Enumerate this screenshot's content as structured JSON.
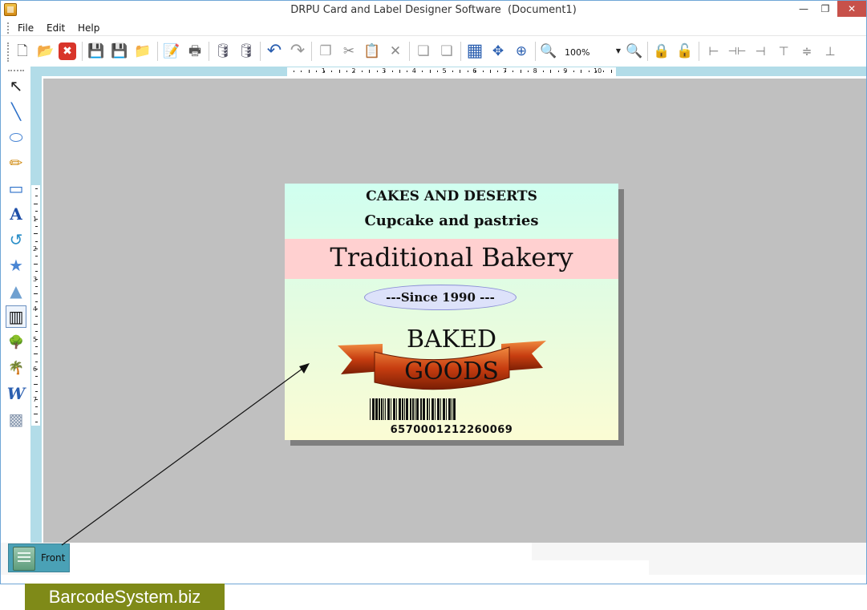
{
  "window": {
    "title": "DRPU Card and Label Designer Software  (Document1)",
    "minimize_glyph": "—",
    "maximize_glyph": "❐",
    "close_glyph": "✕"
  },
  "menu": {
    "items": [
      "File",
      "Edit",
      "Help"
    ]
  },
  "toolbar": {
    "zoom_value": "100%",
    "buttons": [
      {
        "name": "new-icon",
        "glyph": "🗋"
      },
      {
        "name": "open-folder-icon",
        "glyph": "📂"
      },
      {
        "name": "close-document-icon",
        "glyph": "✖"
      },
      {
        "name": "save-icon",
        "glyph": "💾"
      },
      {
        "name": "save-as-icon",
        "glyph": "💾"
      },
      {
        "name": "export-icon",
        "glyph": "📁"
      },
      {
        "name": "properties-icon",
        "glyph": "📝"
      },
      {
        "name": "print-icon",
        "glyph": "🖶"
      },
      {
        "name": "database-add-icon",
        "glyph": "🛢"
      },
      {
        "name": "database-icon",
        "glyph": "🛢"
      },
      {
        "name": "undo-icon",
        "glyph": "↶"
      },
      {
        "name": "redo-icon",
        "glyph": "↷"
      },
      {
        "name": "copy-icon",
        "glyph": "❐"
      },
      {
        "name": "cut-icon",
        "glyph": "✂"
      },
      {
        "name": "paste-icon",
        "glyph": "📋"
      },
      {
        "name": "delete-icon",
        "glyph": "✕"
      },
      {
        "name": "bring-forward-icon",
        "glyph": "❏"
      },
      {
        "name": "send-backward-icon",
        "glyph": "❏"
      },
      {
        "name": "grid-icon",
        "glyph": "▦"
      },
      {
        "name": "fit-page-icon",
        "glyph": "✥"
      },
      {
        "name": "zoom-fit-icon",
        "glyph": "⊕"
      },
      {
        "name": "zoom-in-icon",
        "glyph": "🔍"
      },
      {
        "name": "zoom-out-icon",
        "glyph": "🔍"
      },
      {
        "name": "lock-icon",
        "glyph": "🔒"
      },
      {
        "name": "unlock-icon",
        "glyph": "🔓"
      },
      {
        "name": "align-left-icon",
        "glyph": "⊢"
      },
      {
        "name": "align-center-icon",
        "glyph": "⊣⊢"
      },
      {
        "name": "align-right-icon",
        "glyph": "⊣"
      },
      {
        "name": "align-top-icon",
        "glyph": "⊤"
      },
      {
        "name": "align-middle-icon",
        "glyph": "≑"
      },
      {
        "name": "align-bottom-icon",
        "glyph": "⊥"
      }
    ]
  },
  "palette": {
    "tools": [
      {
        "name": "select-move-tool-icon",
        "glyph": "↖"
      },
      {
        "name": "line-tool-icon",
        "glyph": "╲"
      },
      {
        "name": "ellipse-tool-icon",
        "glyph": "⬭"
      },
      {
        "name": "pencil-tool-icon",
        "glyph": "✏"
      },
      {
        "name": "rectangle-tool-icon",
        "glyph": "▭"
      },
      {
        "name": "text-tool-icon",
        "glyph": "A"
      },
      {
        "name": "curve-tool-icon",
        "glyph": "↺"
      },
      {
        "name": "star-tool-icon",
        "glyph": "★"
      },
      {
        "name": "triangle-tool-icon",
        "glyph": "▲"
      },
      {
        "name": "barcode-tool-icon",
        "glyph": "▥"
      },
      {
        "name": "picture-tool-icon",
        "glyph": "🌳"
      },
      {
        "name": "image-library-tool-icon",
        "glyph": "🌴"
      },
      {
        "name": "wordart-tool-icon",
        "glyph": "W"
      },
      {
        "name": "background-tool-icon",
        "glyph": "▩"
      }
    ]
  },
  "rulers": {
    "horizontal_numbers": [
      "1",
      "2",
      "3",
      "4",
      "5",
      "6",
      "7",
      "8",
      "9",
      "10"
    ],
    "vertical_numbers": [
      "1",
      "2",
      "3",
      "4",
      "5",
      "6",
      "7"
    ]
  },
  "label": {
    "line1": "CAKES AND DESERTS",
    "line2": "Cupcake and pastries",
    "headline": "Traditional Bakery",
    "since": "---Since 1990 ---",
    "baked": "BAKED",
    "goods": "GOODS",
    "barcode_value": "6570001212260069",
    "colors": {
      "band": "#ffd0d0",
      "ellipse": "#dde2fa",
      "ribbon": "#c73d10"
    }
  },
  "page_tabs": {
    "front": "Front"
  },
  "watermark": {
    "text": "BarcodeSystem.biz"
  }
}
